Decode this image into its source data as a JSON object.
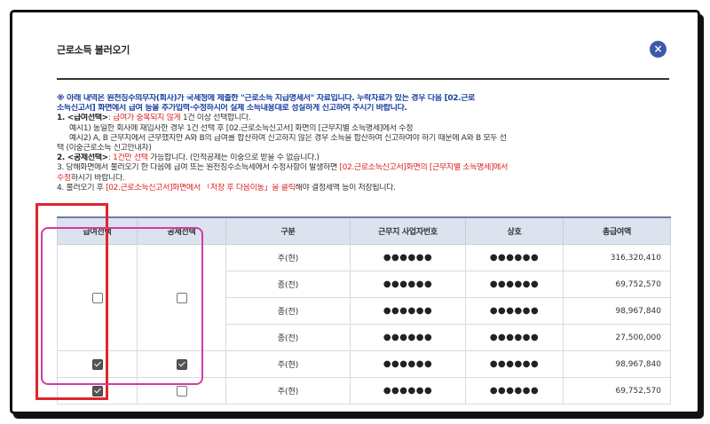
{
  "dialog": {
    "title": "근로소득 불러오기",
    "close_glyph": "×"
  },
  "notice": {
    "lead_line1": "※ 아래 내역은 원천징수의무자(회사)가 국세청에 제출한 \"근로소득 지급명세서\" 자료입니다. 누락자료가 있는 경우 다음 [02.근로",
    "lead_line2": "소득신고서] 화면에서 급여 등을 추가입력·수정하시어 실제 소득내용대로 성실하게 신고하여 주시기 바랍니다.",
    "item1_label": "1. <급여선택>",
    "item1_red": ": 급여가 중복되지 않게",
    "item1_rest": " 1건 이상 선택합니다.",
    "ex1": "예시1) 동일한 회사에 재입사한 경우 1건 선택 후 [02.근로소득신고서] 화면의 [근무지별 소득명세]에서 수정",
    "ex2_line1": "예시2) A, B 근무지에서 근무했지만 A와 B의 급여를 합산하여 신고하지 않은 경우 소득을 합산하여 신고하여야 하기 때문에 A와 B 모두 선",
    "ex2_line2": "택 (이중근로소득 신고안내자)",
    "item2_label": "2. <공제선택>",
    "item2_red": ": 1건만 선택",
    "item2_rest": " 가능합니다. (인적공제는 이중으로 받을 수 없습니다.)",
    "item3_prefix": "3. 당해화면에서 불러오기 한 다음에 급여 또는 원천징수소득세에서 수정사항이 발생하면 ",
    "item3_red1": "[02.근로소득신고서]화면의 [근무지별 소득명세]에서",
    "item3_red2": "수정",
    "item3_rest": "하시기 바랍니다.",
    "item4_prefix": "4. 불러오기 후 ",
    "item4_red": "[02.근로소득신고서]화면에서 「저장 후 다음이동」을 클릭",
    "item4_rest": "해야 결정세액 등이 저장됩니다."
  },
  "table": {
    "headers": [
      "급여선택",
      "공제선택",
      "구분",
      "근무지 사업자번호",
      "상호",
      "총급여액"
    ],
    "rows": [
      {
        "gubun": "주(현)",
        "bizno": "●●●●●●",
        "name": "●●●●●●",
        "total": "316,320,410"
      },
      {
        "gubun": "종(전)",
        "bizno": "●●●●●●",
        "name": "●●●●●●",
        "total": "69,752,570"
      },
      {
        "gubun": "종(전)",
        "bizno": "●●●●●●",
        "name": "●●●●●●",
        "total": "98,967,840"
      },
      {
        "gubun": "종(전)",
        "bizno": "●●●●●●",
        "name": "●●●●●●",
        "total": "27,500,000"
      },
      {
        "gubun": "주(현)",
        "bizno": "●●●●●●",
        "name": "●●●●●●",
        "total": "98,967,840"
      },
      {
        "gubun": "주(현)",
        "bizno": "●●●●●●",
        "name": "●●●●●●",
        "total": "69,752,570"
      }
    ],
    "group_checkboxes": [
      {
        "salary_checked": false,
        "deduction_checked": false
      },
      {
        "salary_checked": true,
        "deduction_checked": true
      },
      {
        "salary_checked": true,
        "deduction_checked": false
      }
    ]
  },
  "colors": {
    "lead_text": "#1b3fa0",
    "emphasis_red": "#d22",
    "close_button": "#3a5ba8",
    "highlight_red": "#e0262b",
    "highlight_pink": "#d23ca3"
  }
}
